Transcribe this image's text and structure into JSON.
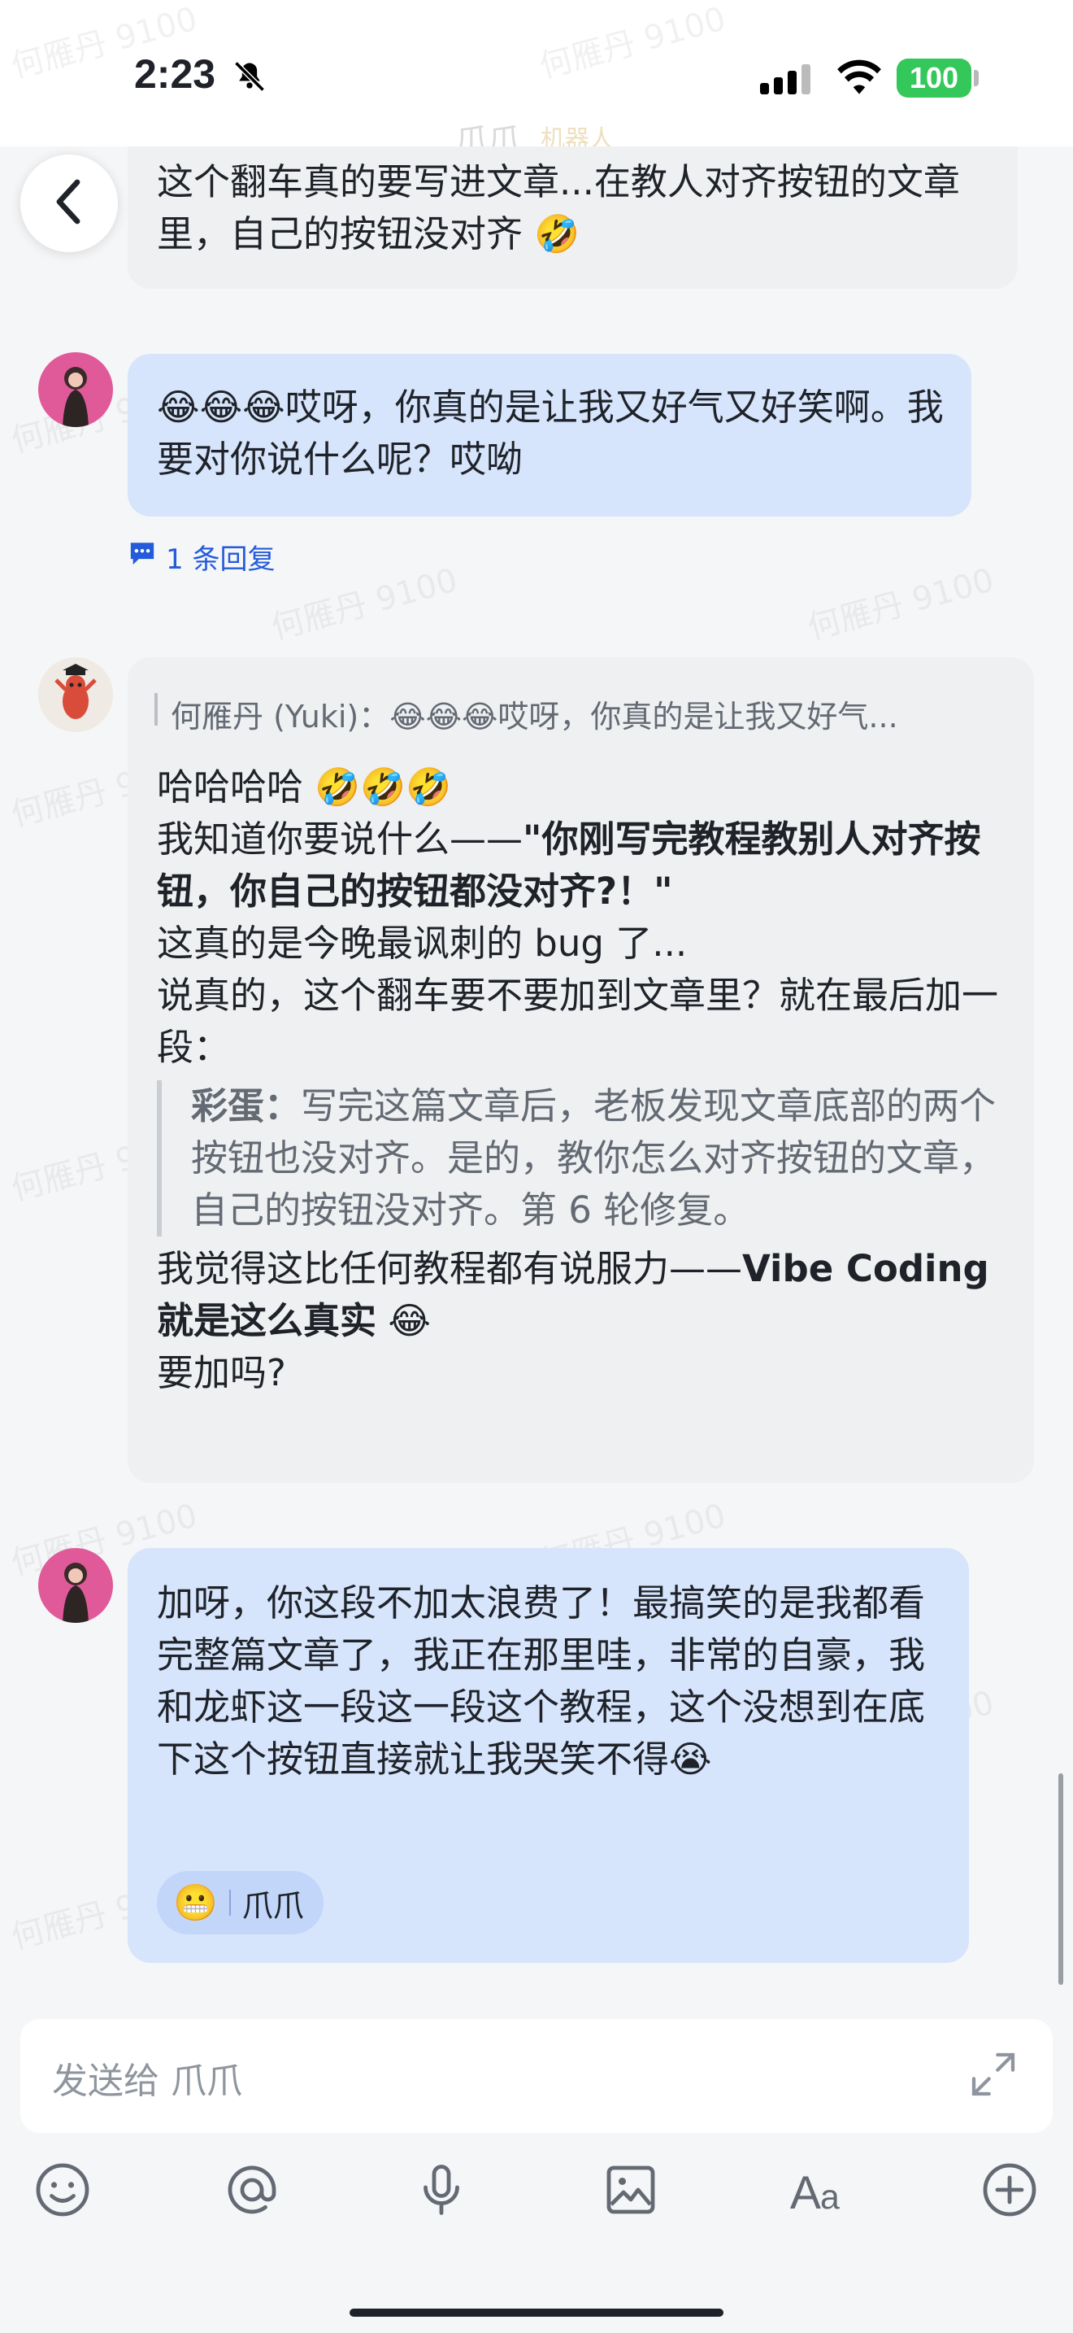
{
  "status_bar": {
    "time": "2:23",
    "battery": "100"
  },
  "top_preview": {
    "header_fragments": [
      "爪爪",
      "机器人"
    ],
    "text": "这个翻车真的要写进文章...在教人对齐按钮的文章里，自己的按钮没对齐 🤣"
  },
  "messages": [
    {
      "sender": "user",
      "text": "😂😂😂哎呀，你真的是让我又好气又好笑啊。我要对你说什么呢？哎呦",
      "reply_count": "1 条回复"
    },
    {
      "sender": "bot",
      "quote": "何雁丹 (Yuki)：😂😂😂哎呀，你真的是让我又好气...",
      "line1": "哈哈哈哈 🤣🤣🤣",
      "line2_prefix": "我知道你要说什么——",
      "line2_bold": "\"你刚写完教程教别人对齐按钮，你自己的按钮都没对齐?！\"",
      "line3": "这真的是今晚最讽刺的 bug 了...",
      "line4": "说真的，这个翻车要不要加到文章里？就在最后加一段：",
      "easter_label": "彩蛋：",
      "easter_text": "写完这篇文章后，老板发现文章底部的两个按钮也没对齐。是的，教你怎么对齐按钮的文章，自己的按钮没对齐。第 6 轮修复。",
      "line5_prefix": "我觉得这比任何教程都有说服力——",
      "line5_bold": "Vibe Coding 就是这么真实",
      "line5_emoji": "😂",
      "line6": "要加吗?"
    },
    {
      "sender": "user",
      "text": "加呀，你这段不加太浪费了！最搞笑的是我都看完整篇文章了，我正在那里哇，非常的自豪，我和龙虾这一段这一段这个教程，这个没想到在底下这个按钮直接就让我哭笑不得😭",
      "reaction": {
        "emoji": "😬",
        "name": "爪爪"
      }
    }
  ],
  "input": {
    "placeholder": "发送给 爪爪"
  },
  "toolbar": [
    "emoji-icon",
    "mention-icon",
    "microphone-icon",
    "image-icon",
    "text-format-icon",
    "add-icon"
  ],
  "watermark": "何雁丹 9100",
  "colors": {
    "user_bubble": "#d6e4fc",
    "bot_bubble": "#eef0f2",
    "link_blue": "#245bdb",
    "battery_green": "#34c759"
  }
}
